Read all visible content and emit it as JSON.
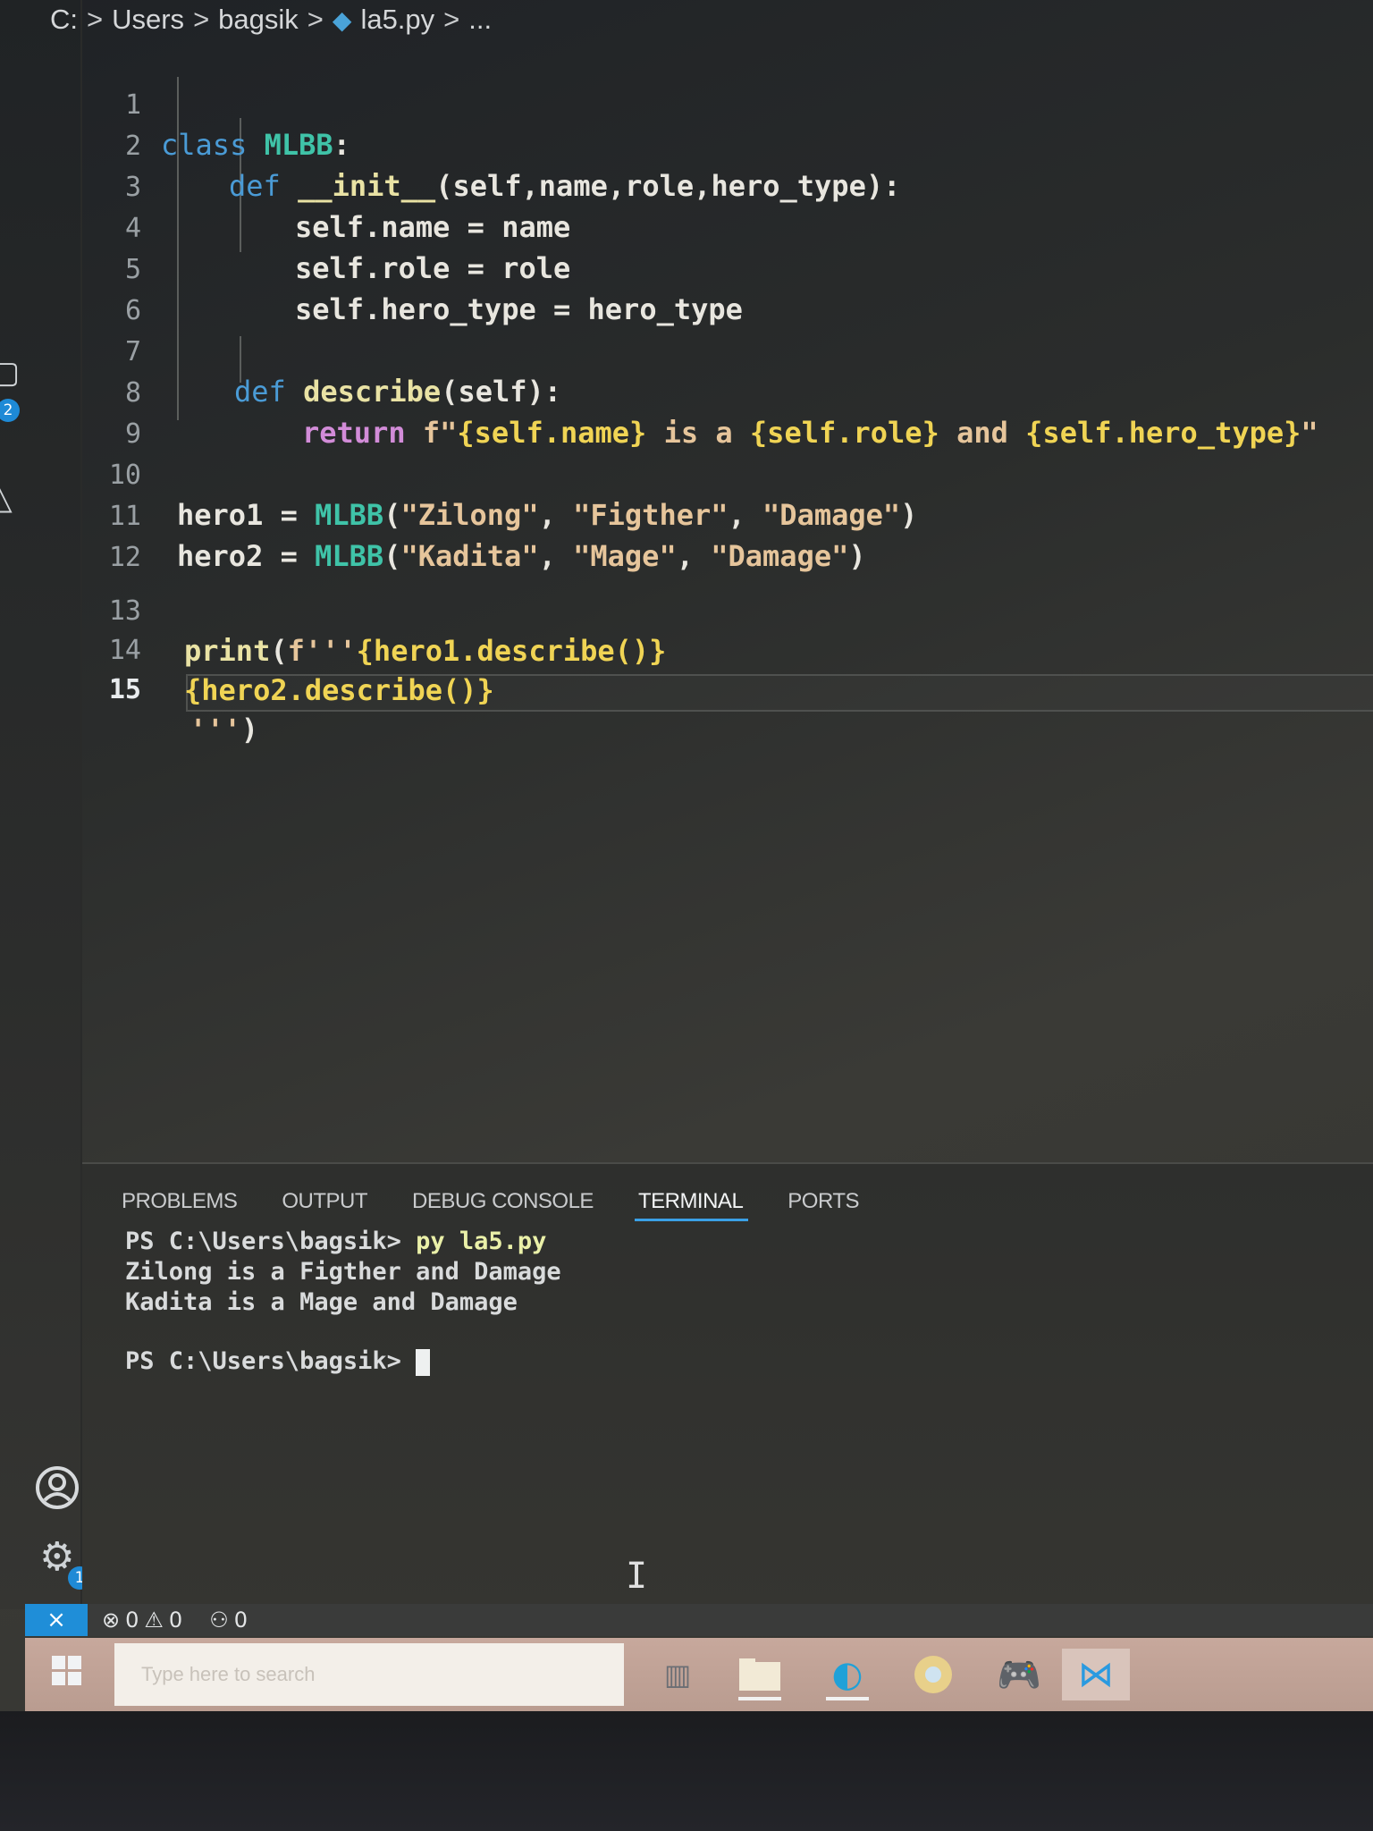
{
  "breadcrumb": {
    "drive": "C:",
    "folder1": "Users",
    "folder2": "bagsik",
    "file": "la5.py",
    "ellipsis": "...",
    "separator": ">"
  },
  "editor": {
    "lines": [
      {
        "n": "1"
      },
      {
        "n": "2"
      },
      {
        "n": "3"
      },
      {
        "n": "4"
      },
      {
        "n": "5"
      },
      {
        "n": "6"
      },
      {
        "n": "7"
      },
      {
        "n": "8"
      },
      {
        "n": "9"
      },
      {
        "n": "10"
      },
      {
        "n": "11"
      },
      {
        "n": "12"
      },
      {
        "n": "13"
      },
      {
        "n": "14"
      },
      {
        "n": "15"
      }
    ],
    "code": {
      "l1_kw": "class",
      "l1_name": "MLBB",
      "l1_colon": ":",
      "l2_kw": "def",
      "l2_fn": "__init__",
      "l2_args": "(self,name,role,hero_type):",
      "l3": "self.name = name",
      "l4": "self.role = role",
      "l5": "self.hero_type = hero_type",
      "l7_kw": "def",
      "l7_fn": "describe",
      "l7_args": "(self):",
      "l8_kw": "return",
      "l8_pre": " f\"",
      "l8_b1": "{self.name}",
      "l8_t1": " is a ",
      "l8_b2": "{self.role}",
      "l8_t2": " and ",
      "l8_b3": "{self.hero_type}",
      "l8_post": "\"",
      "l10_var": "hero1 = ",
      "l10_cls": "MLBB",
      "l10_open": "(",
      "l10_s1": "\"Zilong\"",
      "l10_c1": ", ",
      "l10_s2": "\"Figther\"",
      "l10_c2": ", ",
      "l10_s3": "\"Damage\"",
      "l10_close": ")",
      "l11_var": "hero2 = ",
      "l11_cls": "MLBB",
      "l11_open": "(",
      "l11_s1": "\"Kadita\"",
      "l11_c1": ", ",
      "l11_s2": "\"Mage\"",
      "l11_c2": ", ",
      "l11_s3": "\"Damage\"",
      "l11_close": ")",
      "l13_fn": "print",
      "l13_open": "(",
      "l13_str": "f'''",
      "l13_expr": "{hero1.describe()}",
      "l14_expr": "{hero2.describe()}",
      "l15_str": "'''",
      "l15_close": ")"
    }
  },
  "panel": {
    "tabs": [
      {
        "label": "PROBLEMS"
      },
      {
        "label": "OUTPUT"
      },
      {
        "label": "DEBUG CONSOLE"
      },
      {
        "label": "TERMINAL"
      },
      {
        "label": "PORTS"
      }
    ],
    "active_tab": "TERMINAL",
    "terminal": {
      "prompt1": "PS C:\\Users\\bagsik> ",
      "command": "py la5.py",
      "out1": "Zilong is a Figther and Damage",
      "out2": "Kadita is a Mage and Damage",
      "prompt2": "PS C:\\Users\\bagsik> "
    }
  },
  "activity_bar": {
    "settings_badge": "1",
    "top_badge": "2"
  },
  "status_bar": {
    "errors": "0",
    "warnings": "0",
    "ports": "0"
  },
  "taskbar": {
    "search_placeholder": "Type here to search"
  },
  "colors": {
    "accent": "#1f8ed8",
    "keyword": "#4a9bd6",
    "class_name": "#3fc3a8",
    "string": "#e6c59b",
    "brace": "#f0d454"
  }
}
